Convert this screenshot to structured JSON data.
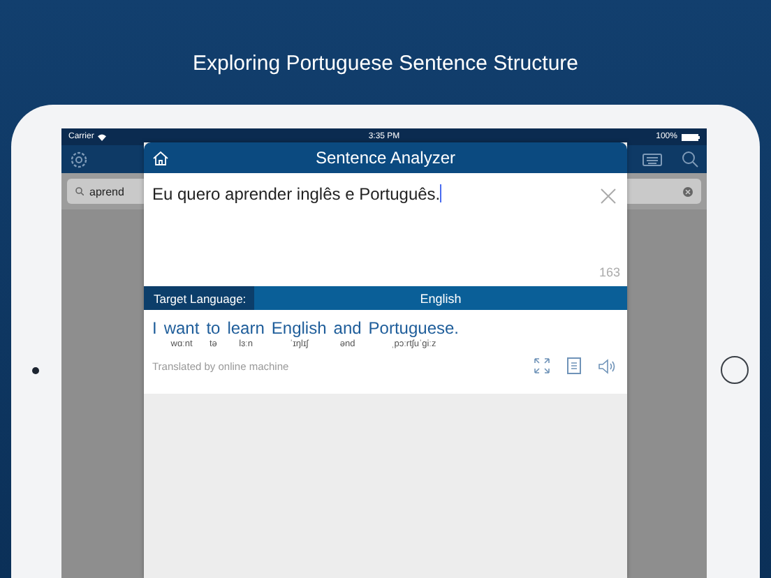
{
  "headline": "Exploring Portuguese Sentence Structure",
  "status_bar": {
    "carrier": "Carrier",
    "time": "3:35 PM",
    "battery": "100%"
  },
  "search": {
    "value": "aprend"
  },
  "analyzer": {
    "title": "Sentence Analyzer",
    "input": "Eu quero aprender inglês e Português.",
    "char_count": "163",
    "target_label": "Target Language:",
    "target_language": "English",
    "translation": [
      {
        "word": "I"
      },
      {
        "word": "want",
        "phonetic": "wɑːnt"
      },
      {
        "word": "to",
        "phonetic": "tə"
      },
      {
        "word": "learn",
        "phonetic": "lɜːn"
      },
      {
        "word": "English",
        "phonetic": "ˈɪŋlɪʃ"
      },
      {
        "word": "and",
        "phonetic": "ənd"
      },
      {
        "word": "Portuguese.",
        "phonetic": "ˌpɔːrtʃuˈɡiːz"
      }
    ],
    "source_note": "Translated by online machine"
  }
}
